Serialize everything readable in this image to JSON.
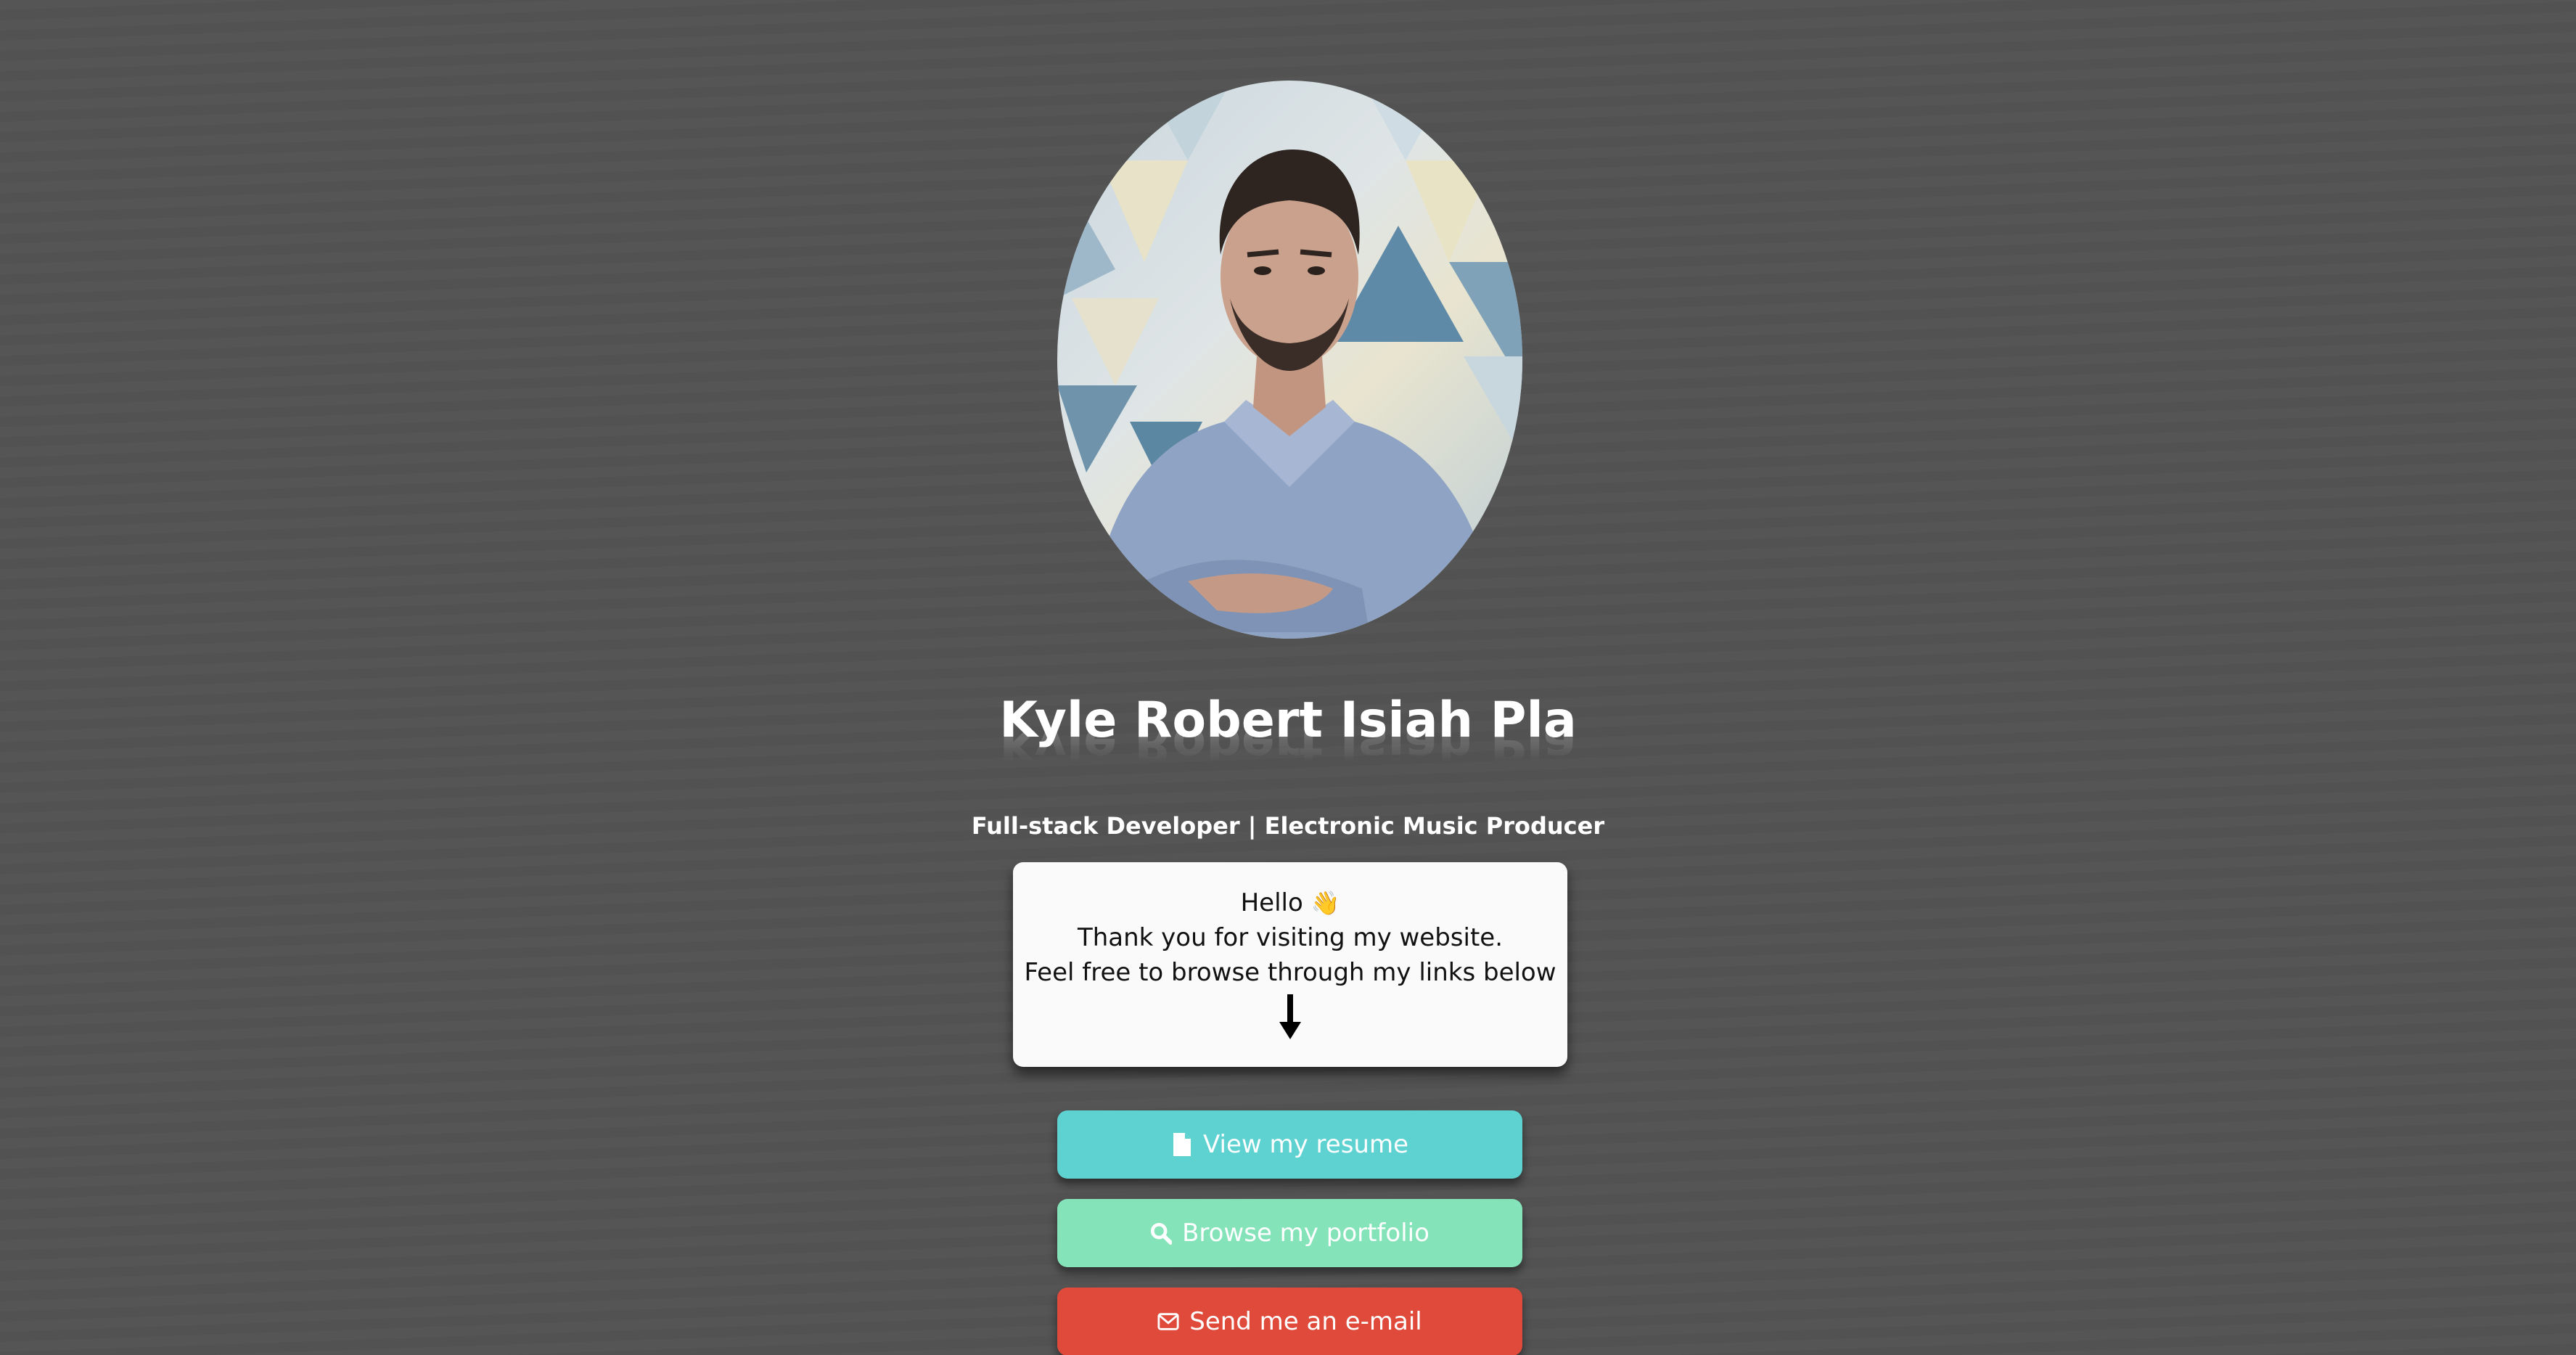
{
  "profile": {
    "name": "Kyle Robert Isiah Pla",
    "subtitle": "Full-stack Developer | Electronic Music Producer"
  },
  "intro": {
    "greeting": "Hello",
    "wave_emoji": "👋",
    "line2": "Thank you for visiting my website.",
    "line3": "Feel free to browse through my links below"
  },
  "buttons": {
    "resume": {
      "label": "View my resume",
      "icon": "file-icon",
      "color": "#5ed1d1"
    },
    "portfolio": {
      "label": "Browse my portfolio",
      "icon": "search-icon",
      "color": "#84e3b8"
    },
    "email": {
      "label": "Send me an e-mail",
      "icon": "envelope-icon",
      "color": "#df4a3b"
    }
  },
  "colors": {
    "background": "#535353",
    "card": "#fafafa"
  }
}
